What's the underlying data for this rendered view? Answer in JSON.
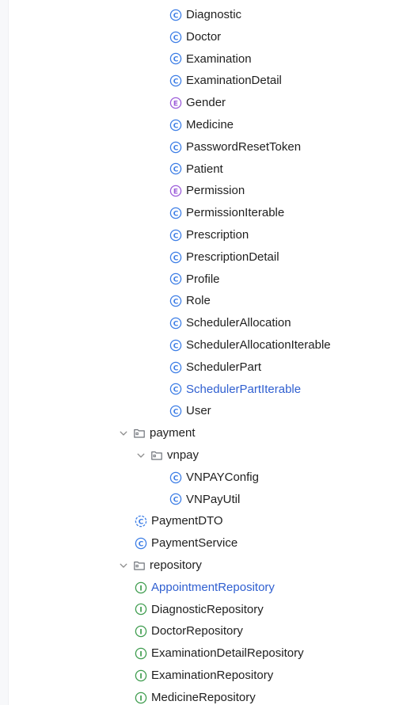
{
  "tree": {
    "items": [
      {
        "label": "Diagnostic",
        "kind": "class",
        "level": 2
      },
      {
        "label": "Doctor",
        "kind": "class",
        "level": 2
      },
      {
        "label": "Examination",
        "kind": "class",
        "level": 2
      },
      {
        "label": "ExaminationDetail",
        "kind": "class",
        "level": 2
      },
      {
        "label": "Gender",
        "kind": "enum",
        "level": 2
      },
      {
        "label": "Medicine",
        "kind": "class",
        "level": 2
      },
      {
        "label": "PasswordResetToken",
        "kind": "class",
        "level": 2
      },
      {
        "label": "Patient",
        "kind": "class",
        "level": 2
      },
      {
        "label": "Permission",
        "kind": "enum",
        "level": 2
      },
      {
        "label": "PermissionIterable",
        "kind": "class",
        "level": 2
      },
      {
        "label": "Prescription",
        "kind": "class",
        "level": 2
      },
      {
        "label": "PrescriptionDetail",
        "kind": "class",
        "level": 2
      },
      {
        "label": "Profile",
        "kind": "class",
        "level": 2
      },
      {
        "label": "Role",
        "kind": "class",
        "level": 2
      },
      {
        "label": "SchedulerAllocation",
        "kind": "class",
        "level": 2
      },
      {
        "label": "SchedulerAllocationIterable",
        "kind": "class",
        "level": 2
      },
      {
        "label": "SchedulerPart",
        "kind": "class",
        "level": 2
      },
      {
        "label": "SchedulerPartIterable",
        "kind": "class",
        "level": 2,
        "highlight": true
      },
      {
        "label": "User",
        "kind": "class",
        "level": 2
      },
      {
        "label": "payment",
        "kind": "package",
        "level": 0,
        "expanded": true
      },
      {
        "label": "vnpay",
        "kind": "package",
        "level": 1,
        "expanded": true
      },
      {
        "label": "VNPAYConfig",
        "kind": "class",
        "level": 2
      },
      {
        "label": "VNPayUtil",
        "kind": "class",
        "level": 2
      },
      {
        "label": "PaymentDTO",
        "kind": "record",
        "level": 1
      },
      {
        "label": "PaymentService",
        "kind": "class",
        "level": 1
      },
      {
        "label": "repository",
        "kind": "package",
        "level": 0,
        "expanded": true
      },
      {
        "label": "AppointmentRepository",
        "kind": "interface",
        "level": 1,
        "highlight": true
      },
      {
        "label": "DiagnosticRepository",
        "kind": "interface",
        "level": 1
      },
      {
        "label": "DoctorRepository",
        "kind": "interface",
        "level": 1
      },
      {
        "label": "ExaminationDetailRepository",
        "kind": "interface",
        "level": 1
      },
      {
        "label": "ExaminationRepository",
        "kind": "interface",
        "level": 1
      },
      {
        "label": "MedicineRepository",
        "kind": "interface",
        "level": 1
      }
    ]
  },
  "colors": {
    "class": "#3d7ee6",
    "enum": "#9c5cd9",
    "interface": "#3e9c4e",
    "record": "#3d7ee6",
    "text": "#1f1f1f",
    "highlight": "#2f5fd0",
    "chevron": "#8c8c8c",
    "folder": "#6f737a"
  }
}
